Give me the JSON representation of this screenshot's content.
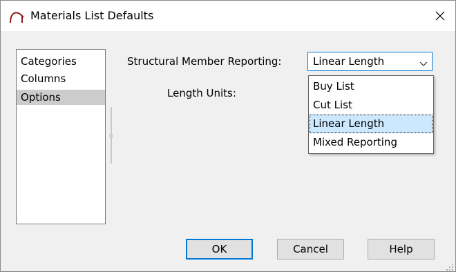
{
  "window": {
    "title": "Materials List Defaults"
  },
  "icons": {
    "app": "arc-icon",
    "close": "close-icon",
    "chevron": "chevron-down-icon"
  },
  "sidebar": {
    "items": [
      {
        "label": "Categories",
        "selected": false
      },
      {
        "label": "Columns",
        "selected": false
      },
      {
        "label": "Options",
        "selected": true
      }
    ]
  },
  "options": {
    "structural_label": "Structural Member Reporting:",
    "structural_value": "Linear Length",
    "length_units_label": "Length Units:",
    "dropdown_options": [
      {
        "label": "Buy List",
        "highlighted": false
      },
      {
        "label": "Cut List",
        "highlighted": false
      },
      {
        "label": "Linear Length",
        "highlighted": true
      },
      {
        "label": "Mixed Reporting",
        "highlighted": false
      }
    ]
  },
  "buttons": {
    "ok": "OK",
    "cancel": "Cancel",
    "help": "Help"
  },
  "colors": {
    "accent": "#0078d7",
    "selection": "#cce8ff",
    "list_selected": "#cccccc"
  }
}
